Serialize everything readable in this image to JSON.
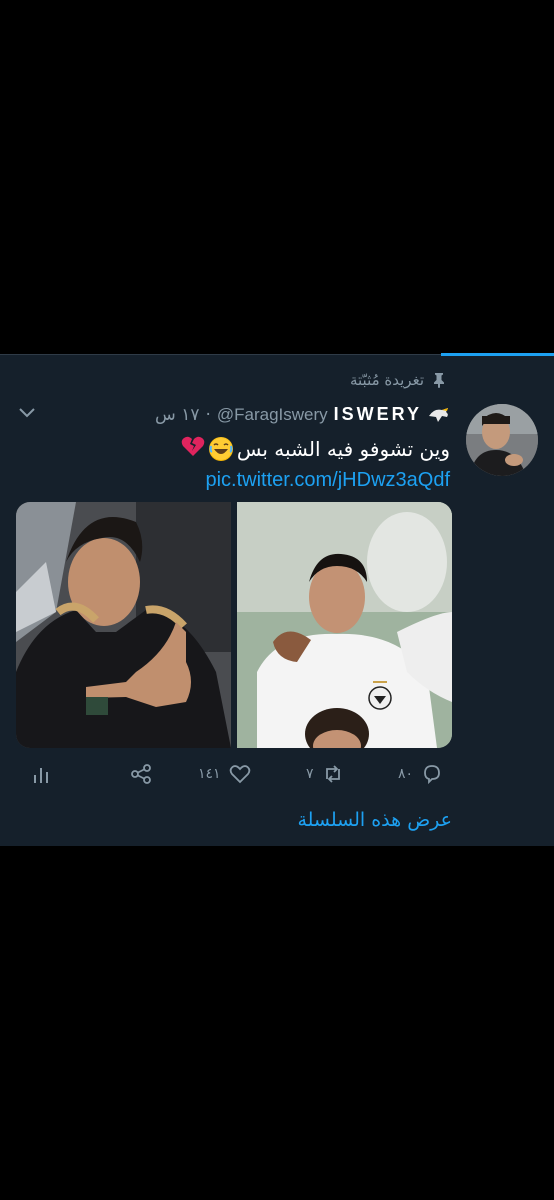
{
  "tweet": {
    "pinned_label": "تغريدة مُثبّتة",
    "display_name": "ISWERY",
    "handle": "@FaragIswery",
    "separator": "·",
    "time": "١٧ س",
    "text": "وين تشوفو فيه الشبه بس",
    "link": "pic.twitter.com/jHDwz3aQdf"
  },
  "actions": {
    "reply_count": "٨٠",
    "retweet_count": "٧",
    "like_count": "١٤١"
  },
  "show_thread_label": "عرض هذه السلسلة",
  "colors": {
    "background": "#15202b",
    "accent": "#1da1f2",
    "muted": "#8899a6"
  }
}
